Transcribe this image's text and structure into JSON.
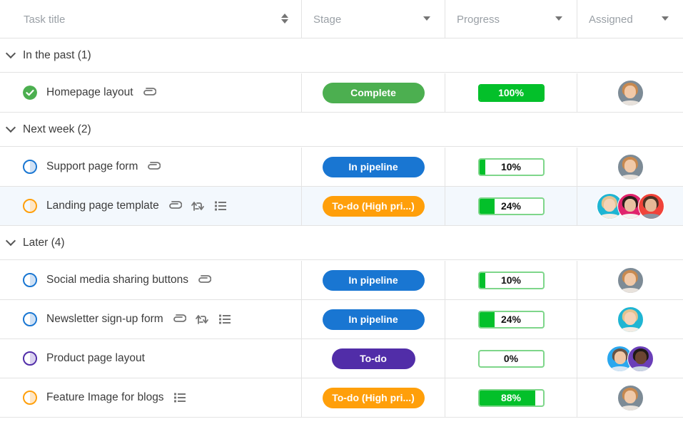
{
  "header": {
    "columns": [
      {
        "label": "Task title",
        "control": "sort-icon"
      },
      {
        "label": "Stage",
        "control": "caret-down-icon"
      },
      {
        "label": "Progress",
        "control": "caret-down-icon"
      },
      {
        "label": "Assigned",
        "control": "caret-down-icon"
      }
    ]
  },
  "colors": {
    "complete": "#4caf50",
    "in_pipeline": "#1976d2",
    "todo_high": "#ff9f0a",
    "todo": "#512da8",
    "progress_fill": "#03c02a",
    "row_highlight": "#f3f8fd"
  },
  "groups": [
    {
      "label": "In the past (1)",
      "tasks": [
        {
          "title": "Homepage layout",
          "status": "complete",
          "icons": [
            "attachment-icon"
          ],
          "stage": "Complete",
          "stage_color": "#4caf50",
          "progress": 100,
          "progress_label": "100%",
          "assignees": [
            "avatar-woman-glasses"
          ]
        }
      ]
    },
    {
      "label": "Next week (2)",
      "tasks": [
        {
          "title": "Support page form",
          "status": "in-pipeline",
          "icons": [
            "attachment-icon"
          ],
          "stage": "In pipeline",
          "stage_color": "#1976d2",
          "progress": 10,
          "progress_label": "10%",
          "assignees": [
            "avatar-woman-glasses"
          ]
        },
        {
          "title": "Landing page template",
          "status": "todo-high",
          "icons": [
            "attachment-icon",
            "recurring-icon",
            "checklist-icon"
          ],
          "stage": "To-do (High pri...)",
          "stage_color": "#ff9f0a",
          "progress": 24,
          "progress_label": "24%",
          "assignees": [
            "avatar-woman-blonde",
            "avatar-woman-dark-hair",
            "avatar-man-beard"
          ],
          "highlighted": true
        }
      ]
    },
    {
      "label": "Later (4)",
      "tasks": [
        {
          "title": "Social media sharing buttons",
          "status": "in-pipeline",
          "icons": [
            "attachment-icon"
          ],
          "stage": "In pipeline",
          "stage_color": "#1976d2",
          "progress": 10,
          "progress_label": "10%",
          "assignees": [
            "avatar-woman-glasses"
          ]
        },
        {
          "title": "Newsletter sign-up form",
          "status": "in-pipeline",
          "icons": [
            "attachment-icon",
            "recurring-icon",
            "checklist-icon"
          ],
          "stage": "In pipeline",
          "stage_color": "#1976d2",
          "progress": 24,
          "progress_label": "24%",
          "assignees": [
            "avatar-woman-blonde"
          ]
        },
        {
          "title": "Product page layout",
          "status": "todo",
          "icons": [],
          "stage": "To-do",
          "stage_color": "#512da8",
          "progress": 0,
          "progress_label": "0%",
          "assignees": [
            "avatar-man-smiling",
            "avatar-man-dark"
          ]
        },
        {
          "title": "Feature Image for blogs",
          "status": "todo-high",
          "icons": [
            "checklist-icon"
          ],
          "stage": "To-do (High pri...)",
          "stage_color": "#ff9f0a",
          "progress": 88,
          "progress_label": "88%",
          "assignees": [
            "avatar-woman-glasses"
          ]
        }
      ]
    }
  ]
}
